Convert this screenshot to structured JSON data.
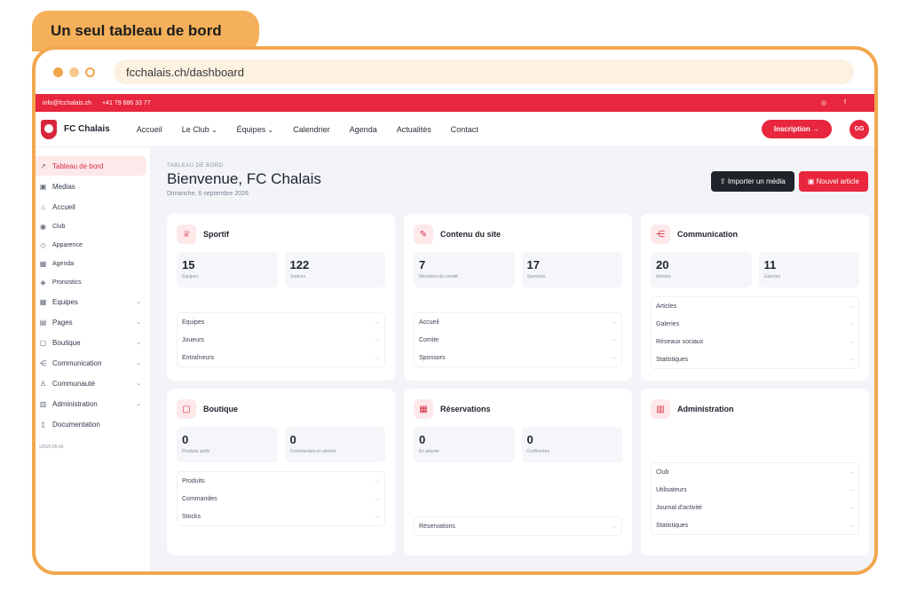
{
  "tag": "Un seul tableau de bord",
  "url": "fcchalais.ch/dashboard",
  "topstrip": {
    "email": "info@fcchalais.ch",
    "phone": "+41 79 686 33 77"
  },
  "nav": {
    "brand": "FC Chalais",
    "items": [
      {
        "label": "Accueil",
        "dropdown": false
      },
      {
        "label": "Le Club",
        "dropdown": true
      },
      {
        "label": "Équipes",
        "dropdown": true
      },
      {
        "label": "Calendrier",
        "dropdown": false
      },
      {
        "label": "Agenda",
        "dropdown": false
      },
      {
        "label": "Actualités",
        "dropdown": false
      },
      {
        "label": "Contact",
        "dropdown": false
      }
    ],
    "cta": "Inscription →",
    "avatar": "GG"
  },
  "sidebar": {
    "items": [
      {
        "label": "Tableau de bord",
        "icon": "↗",
        "active": true
      },
      {
        "label": "Medias",
        "icon": "▣"
      },
      {
        "label": "Accueil",
        "icon": "⌂"
      },
      {
        "label": "Club",
        "icon": "◉",
        "small": true
      },
      {
        "label": "Apparence",
        "icon": "◇",
        "small": true
      },
      {
        "label": "Agenda",
        "icon": "▦",
        "small": true
      },
      {
        "label": "Pronostics",
        "icon": "◈",
        "small": true
      },
      {
        "label": "Equipes",
        "icon": "▦",
        "chevron": true
      },
      {
        "label": "Pages",
        "icon": "▤",
        "chevron": true
      },
      {
        "label": "Boutique",
        "icon": "▢",
        "chevron": true
      },
      {
        "label": "Communication",
        "icon": "⋲",
        "chevron": true
      },
      {
        "label": "Communauté",
        "icon": "♙",
        "chevron": true
      },
      {
        "label": "Administration",
        "icon": "▥",
        "chevron": true
      },
      {
        "label": "Documentation",
        "icon": "▯"
      }
    ],
    "version": "v2026.09.06"
  },
  "main": {
    "eyebrow": "TABLEAU DE BORD",
    "title": "Bienvenue, FC Chalais",
    "date": "Dimanche, 6 septembre 2026",
    "actions": {
      "import": "Importer un média",
      "new": "Nouvel article"
    }
  },
  "cards": [
    {
      "title": "Sportif",
      "icon": "♕",
      "stats": [
        {
          "value": "15",
          "label": "Équipes"
        },
        {
          "value": "122",
          "label": "Joueurs"
        }
      ],
      "links": [
        "Equipes",
        "Joueurs",
        "Entraîneurs"
      ]
    },
    {
      "title": "Contenu du site",
      "icon": "✎",
      "stats": [
        {
          "value": "7",
          "label": "Membres du comité"
        },
        {
          "value": "17",
          "label": "Sponsors"
        }
      ],
      "links": [
        "Accueil",
        "Comite",
        "Sponsors"
      ]
    },
    {
      "title": "Communication",
      "icon": "⋲",
      "stats": [
        {
          "value": "20",
          "label": "Articles"
        },
        {
          "value": "11",
          "label": "Galeries"
        }
      ],
      "links": [
        "Articles",
        "Galeries",
        "Réseaux sociaux",
        "Statistiques"
      ]
    },
    {
      "title": "Boutique",
      "icon": "▢",
      "stats": [
        {
          "value": "0",
          "label": "Produits actifs"
        },
        {
          "value": "0",
          "label": "Commandes en attente"
        }
      ],
      "links": [
        "Produits",
        "Commandes",
        "Stocks"
      ]
    },
    {
      "title": "Réservations",
      "icon": "▦",
      "stats": [
        {
          "value": "0",
          "label": "En attente"
        },
        {
          "value": "0",
          "label": "Confirmées"
        }
      ],
      "links": [
        "Réservations"
      ]
    },
    {
      "title": "Administration",
      "icon": "▥",
      "stats": [],
      "links": [
        "Club",
        "Utilisateurs",
        "Journal d'activité",
        "Statistiques"
      ]
    }
  ]
}
